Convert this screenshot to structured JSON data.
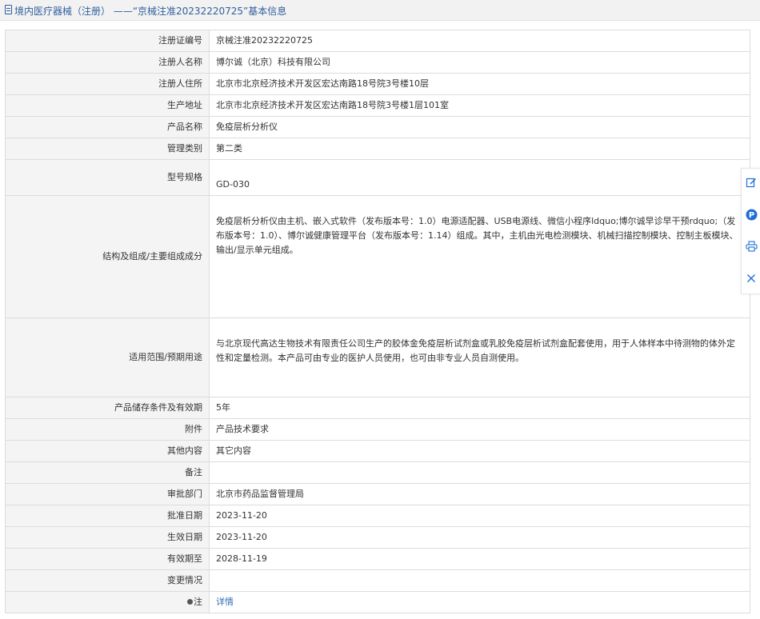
{
  "header": {
    "title": "境内医疗器械（注册） ——“京械注准20232220725”基本信息",
    "icon": "document-icon",
    "color": "#2f5f9c"
  },
  "rows": [
    {
      "label": "注册证编号",
      "value": "京械注准20232220725"
    },
    {
      "label": "注册人名称",
      "value": "博尔诚（北京）科技有限公司"
    },
    {
      "label": "注册人住所",
      "value": "北京市北京经济技术开发区宏达南路18号院3号楼10层"
    },
    {
      "label": "生产地址",
      "value": "北京市北京经济技术开发区宏达南路18号院3号楼1层101室"
    },
    {
      "label": "产品名称",
      "value": "免疫层析分析仪"
    },
    {
      "label": "管理类别",
      "value": "第二类"
    },
    {
      "label": "型号规格",
      "value": "GD-030"
    },
    {
      "label": "结构及组成/主要组成成分",
      "value": "免疫层析分析仪由主机、嵌入式软件（发布版本号：1.0）电源适配器、USB电源线、微信小程序ldquo;博尔诚早诊早干预rdquo;（发布版本号：1.0）、博尔诚健康管理平台（发布版本号：1.14）组成。其中，主机由光电检测模块、机械扫描控制模块、控制主板模块、输出/显示单元组成。"
    },
    {
      "label": "适用范围/预期用途",
      "value": "与北京现代高达生物技术有限责任公司生产的胶体金免疫层析试剂盒或乳胶免疫层析试剂盒配套使用，用于人体样本中待测物的体外定性和定量检测。本产品可由专业的医护人员使用，也可由非专业人员自测使用。"
    },
    {
      "label": "产品储存条件及有效期",
      "value": "5年"
    },
    {
      "label": "附件",
      "value": "产品技术要求"
    },
    {
      "label": "其他内容",
      "value": "其它内容"
    },
    {
      "label": "备注",
      "value": ""
    },
    {
      "label": "审批部门",
      "value": "北京市药品监督管理局"
    },
    {
      "label": "批准日期",
      "value": "2023-11-20"
    },
    {
      "label": "生效日期",
      "value": "2023-11-20"
    },
    {
      "label": "有效期至",
      "value": "2028-11-19"
    },
    {
      "label": "变更情况",
      "value": ""
    },
    {
      "label": "注",
      "value": "详情",
      "icon": "pin-icon"
    }
  ],
  "side_tools": [
    "edit-icon",
    "info-icon",
    "print-icon",
    "close-icon"
  ],
  "colors": {
    "link": "#2f6db5",
    "label_bg": "#f4f4f4",
    "border": "#dcdcdc",
    "tool_blue": "#1e6fd6"
  }
}
